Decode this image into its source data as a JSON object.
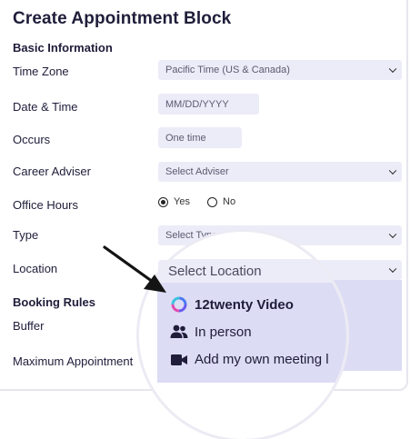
{
  "title": "Create Appointment Block",
  "sections": {
    "basic": "Basic Information",
    "booking": "Booking Rules"
  },
  "labels": {
    "time_zone": "Time Zone",
    "date_time": "Date & Time",
    "occurs": "Occurs",
    "career_adviser": "Career Adviser",
    "office_hours": "Office Hours",
    "type": "Type",
    "location": "Location",
    "buffer": "Buffer",
    "maximum": "Maximum Appointment"
  },
  "fields": {
    "time_zone_value": "Pacific Time (US & Canada)",
    "date_placeholder": "MM/DD/YYYY",
    "occurs_value": "One time",
    "adviser_placeholder": "Select Adviser",
    "type_placeholder": "Select Type",
    "location_placeholder": "Select Location"
  },
  "office_hours_options": {
    "yes": "Yes",
    "no": "No",
    "selected": "Yes"
  },
  "location_options": [
    "12twenty Video",
    "In person",
    "Add my own meeting l"
  ],
  "icons": [
    "chevron-down-icon",
    "12twenty-logo-icon",
    "people-icon",
    "video-camera-icon",
    "pointer-arrow-icon"
  ],
  "colors": {
    "field_bg": "#ececf8",
    "dropdown_bg": "#dcdcf4",
    "text": "#1f1d3a"
  }
}
